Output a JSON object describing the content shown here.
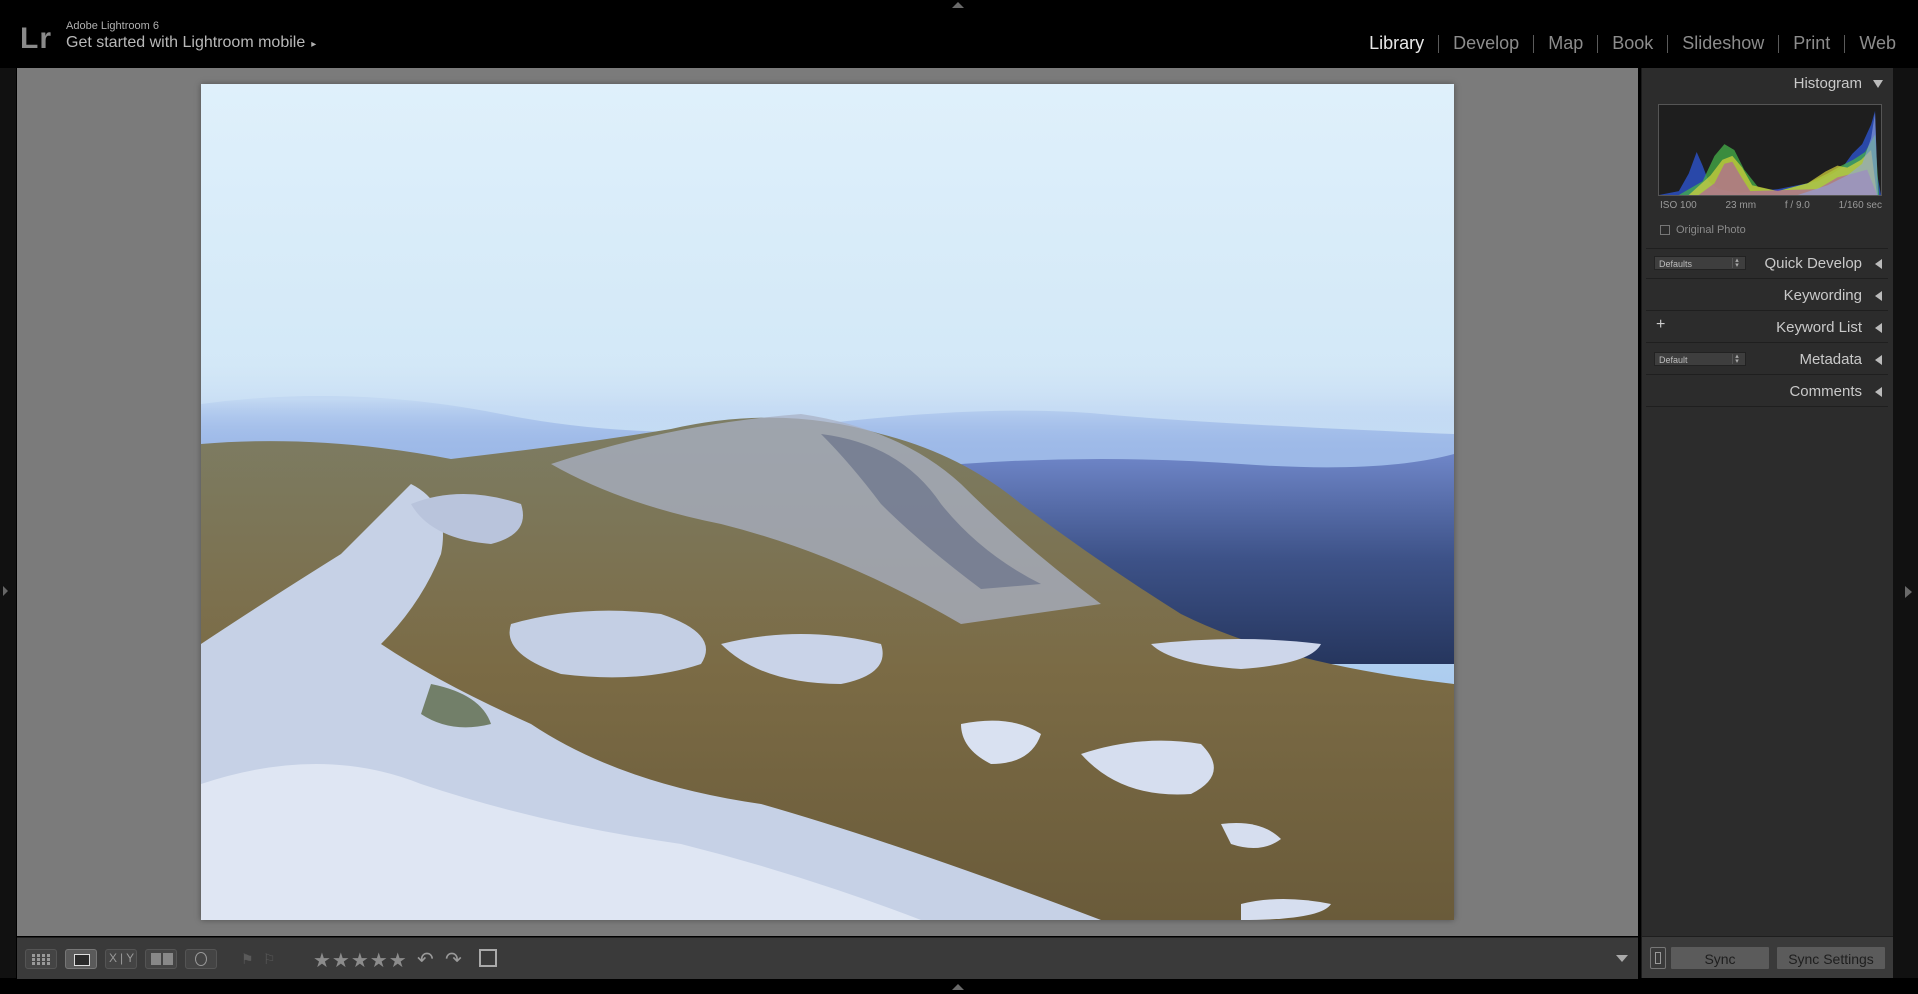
{
  "identity": {
    "logo": "Lr",
    "app_name": "Adobe Lightroom 6",
    "mobile_link": "Get started with Lightroom mobile",
    "mobile_arrow": "▸"
  },
  "modules": [
    "Library",
    "Develop",
    "Map",
    "Book",
    "Slideshow",
    "Print",
    "Web"
  ],
  "active_module": "Library",
  "right_panel": {
    "histogram": {
      "title": "Histogram",
      "exif": {
        "iso": "ISO 100",
        "focal_length": "23 mm",
        "aperture": "f / 9.0",
        "shutter": "1/160 sec"
      },
      "original_photo_label": "Original Photo"
    },
    "quick_develop": {
      "title": "Quick Develop",
      "preset": "Defaults"
    },
    "keywording": {
      "title": "Keywording"
    },
    "keyword_list": {
      "title": "Keyword List",
      "add_icon": "+"
    },
    "metadata": {
      "title": "Metadata",
      "preset": "Default"
    },
    "comments": {
      "title": "Comments"
    },
    "sync_label": "Sync",
    "sync_settings_label": "Sync Settings"
  },
  "toolbar": {
    "compare_label": "X|Y",
    "stars": "★★★★★",
    "rotate_left_icon": "rotate-left-icon",
    "rotate_right_icon": "rotate-right-icon"
  },
  "colors": {
    "background": "#000000",
    "viewer_gray": "#7b7b7b",
    "panel": "#2c2c2c",
    "active_module_text": "#e8e8e8",
    "inactive_module_text": "#8c8c8c"
  }
}
